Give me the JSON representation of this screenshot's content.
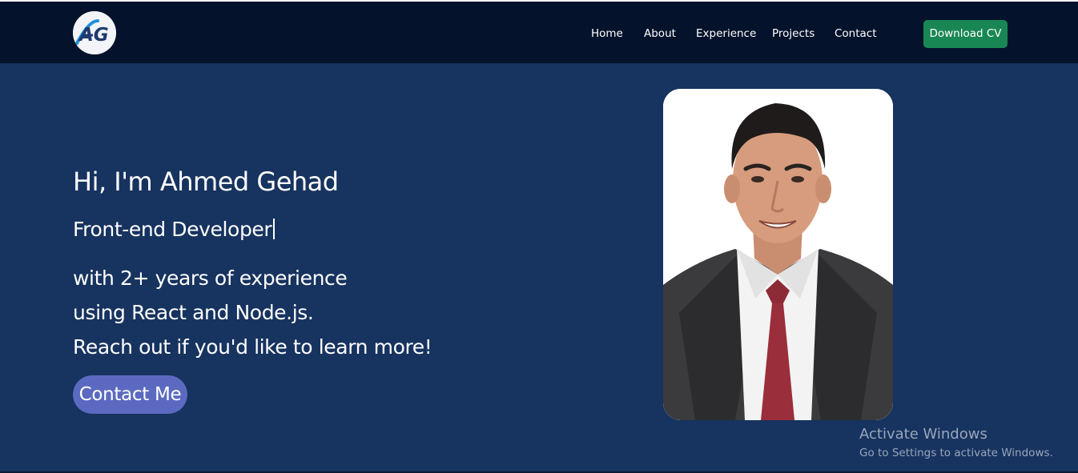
{
  "brand": {
    "logo_text": "AG"
  },
  "nav": {
    "items": [
      {
        "label": "Home"
      },
      {
        "label": "About"
      },
      {
        "label": "Experience"
      },
      {
        "label": "Projects"
      },
      {
        "label": "Contact"
      }
    ],
    "download_label": "Download CV"
  },
  "hero": {
    "title": "Hi, I'm Ahmed Gehad",
    "role": "Front-end Developer",
    "description_lines": [
      "with 2+ years of experience",
      "using React and Node.js.",
      "Reach out if you'd like to learn more!"
    ],
    "contact_label": "Contact Me"
  },
  "os_watermark": {
    "title": "Activate Windows",
    "subtitle": "Go to Settings to activate Windows."
  },
  "colors": {
    "nav_background": "#04132b",
    "page_background": "#17335f",
    "download_button": "#198754",
    "contact_button": "#5b6ac0"
  },
  "icons": {
    "logo": "ag-monogram-logo",
    "portrait": "profile-photo"
  }
}
